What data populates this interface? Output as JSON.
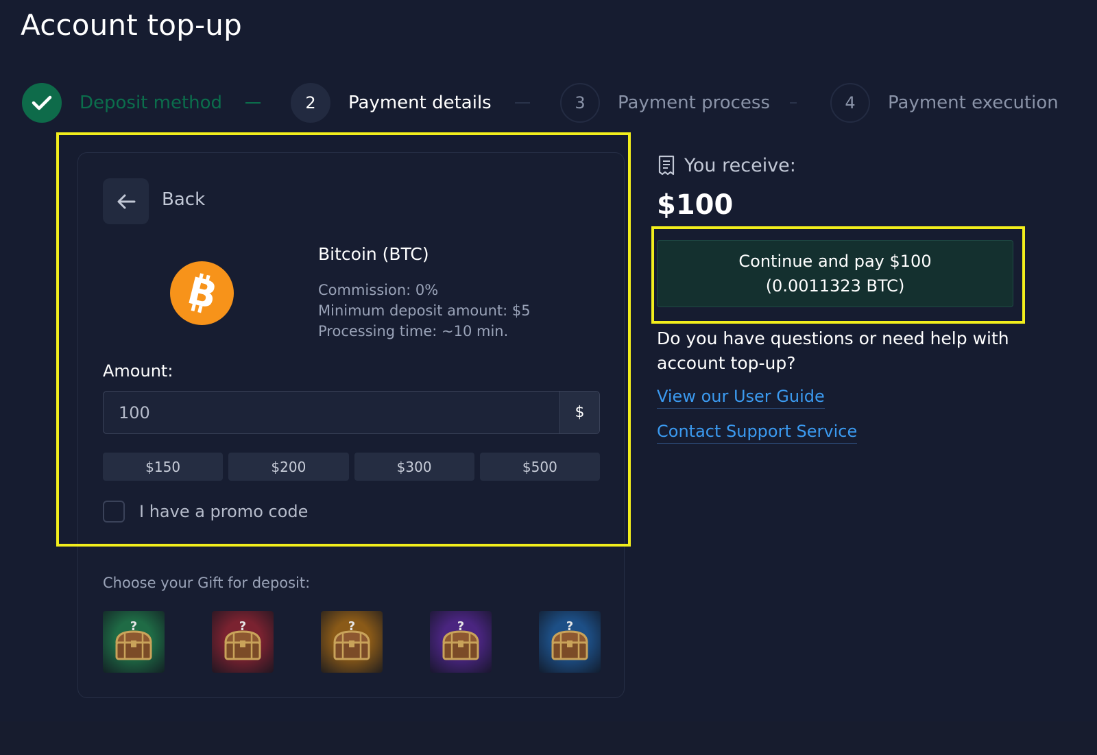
{
  "page": {
    "title": "Account top-up"
  },
  "stepper": {
    "steps": [
      {
        "number": "",
        "label": "Deposit method",
        "state": "done"
      },
      {
        "number": "2",
        "label": "Payment details",
        "state": "active"
      },
      {
        "number": "3",
        "label": "Payment process",
        "state": "pending"
      },
      {
        "number": "4",
        "label": "Payment execution",
        "state": "pending"
      }
    ]
  },
  "card": {
    "back_label": "Back",
    "method": {
      "name": "Bitcoin (BTC)",
      "commission": "Commission: 0%",
      "minimum": "Minimum deposit amount: $5",
      "processing": "Processing time: ~10 min."
    },
    "amount_label": "Amount:",
    "amount_value": "100",
    "currency_symbol": "$",
    "presets": [
      "$150",
      "$200",
      "$300",
      "$500"
    ],
    "promo_label": "I have a promo code",
    "gift_title": "Choose your Gift for deposit:",
    "gifts": [
      {
        "name": "green-chest",
        "color": "#1f6b45"
      },
      {
        "name": "red-chest",
        "color": "#7a2230"
      },
      {
        "name": "gold-chest",
        "color": "#8a5a18"
      },
      {
        "name": "purple-chest",
        "color": "#4a2580"
      },
      {
        "name": "blue-chest",
        "color": "#1d4f86"
      }
    ],
    "gift_glyph": "?"
  },
  "summary": {
    "receive_label": "You receive:",
    "receive_amount": "$100",
    "pay_button_line1": "Continue and pay $100",
    "pay_button_line2": "(0.0011323 BTC)",
    "help_text": "Do you have questions or need help with account top-up?",
    "link_guide": "View our User Guide",
    "link_support": "Contact Support Service"
  },
  "colors": {
    "background": "#161c30",
    "success": "#0e6b4a",
    "accent_link": "#3b9af0",
    "bitcoin": "#f7931a",
    "highlight": "#f2ee1c"
  }
}
